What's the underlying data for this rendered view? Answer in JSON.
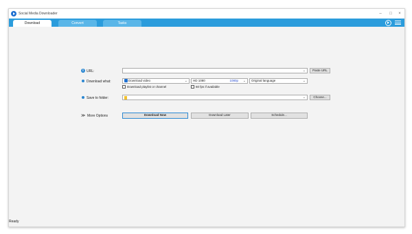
{
  "window": {
    "title": "Social Media Downloader"
  },
  "tabs": [
    "Download",
    "Convert",
    "Tasks"
  ],
  "form": {
    "url_label": "URL:",
    "url_value": "",
    "paste_button": "Paste URL",
    "download_what_label": "Download what:",
    "download_what_value": "Download video",
    "quality_value": "HD 1080",
    "resolution_value": "1080p",
    "language_value": "Original language",
    "playlist_checkbox_label": "Download playlist or channel",
    "fps_checkbox_label": "60 fps if available",
    "save_to_label": "Save to folder:",
    "save_to_value": "",
    "choose_button": "Choose...",
    "more_options_label": "More Options"
  },
  "actions": {
    "download_now": "Download Now",
    "download_later": "Download Later",
    "schedule": "Schedule..."
  },
  "status": {
    "text": "Ready"
  },
  "colors": {
    "tabbar": "#2b9cdc",
    "accent": "#2b87d1"
  },
  "icons": [
    "app-logo-icon",
    "minimize-icon",
    "maximize-icon",
    "close-icon",
    "play-icon",
    "menu-icon",
    "info-icon",
    "chevron-down-icon",
    "folder-icon",
    "double-chevron-icon"
  ]
}
